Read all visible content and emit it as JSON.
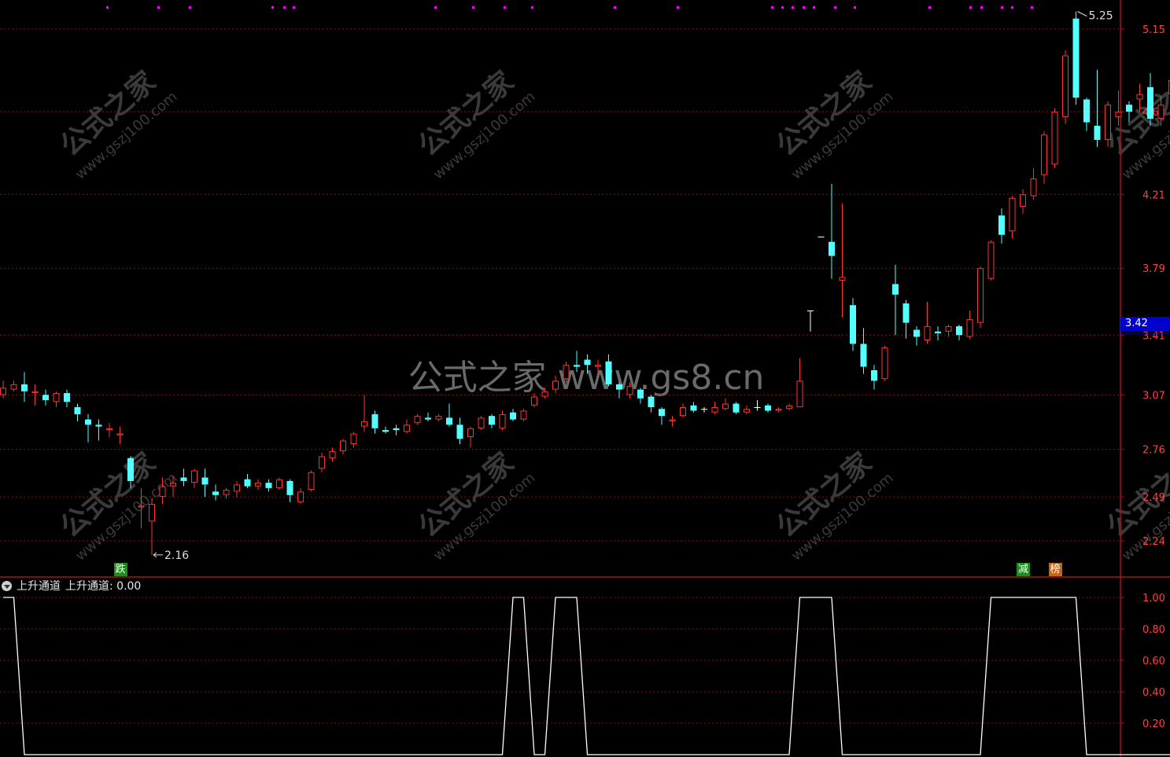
{
  "chart_data": [
    {
      "type": "candlestick",
      "price_axis": {
        "ticks": [
          "5.15",
          "4.68",
          "4.21",
          "3.79",
          "3.41",
          "3.07",
          "2.76",
          "2.49",
          "2.24"
        ],
        "ylim": [
          2.05,
          5.35
        ]
      },
      "current_price_label": "3.42",
      "max_annotation": "5.25",
      "min_annotation": "2.16",
      "watermark_center": "公式之家 www.gs8.cn",
      "watermark_tiles": [
        "公式之家",
        "www.gszj100.com"
      ],
      "signals": [
        {
          "text": "跌",
          "color": "#1e8c1e",
          "bar": 11
        },
        {
          "text": "减",
          "color": "#1e8c1e",
          "bar": 96
        },
        {
          "text": "榜",
          "color": "#c86414",
          "bar": 99
        }
      ],
      "candles": [
        [
          3.07,
          3.11,
          3.05,
          3.15
        ],
        [
          3.1,
          3.13,
          3.09,
          3.15
        ],
        [
          3.13,
          3.09,
          3.03,
          3.2
        ],
        [
          3.08,
          3.09,
          3.01,
          3.13
        ],
        [
          3.07,
          3.04,
          3.01,
          3.1
        ],
        [
          3.03,
          3.08,
          3.0,
          3.09
        ],
        [
          3.08,
          3.03,
          3.0,
          3.1
        ],
        [
          3.0,
          2.96,
          2.92,
          3.02
        ],
        [
          2.93,
          2.9,
          2.8,
          2.96
        ],
        [
          2.9,
          2.89,
          2.81,
          2.93
        ],
        [
          2.87,
          2.88,
          2.83,
          2.91
        ],
        [
          2.84,
          2.85,
          2.79,
          2.89
        ],
        [
          2.71,
          2.58,
          2.54,
          2.72
        ],
        [
          2.43,
          2.44,
          2.31,
          2.54
        ],
        [
          2.35,
          2.45,
          2.16,
          2.48
        ],
        [
          2.49,
          2.55,
          2.45,
          2.6
        ],
        [
          2.55,
          2.57,
          2.49,
          2.61
        ],
        [
          2.6,
          2.58,
          2.55,
          2.65
        ],
        [
          2.57,
          2.64,
          2.54,
          2.65
        ],
        [
          2.6,
          2.56,
          2.49,
          2.65
        ],
        [
          2.52,
          2.5,
          2.47,
          2.56
        ],
        [
          2.5,
          2.53,
          2.48,
          2.54
        ],
        [
          2.52,
          2.56,
          2.49,
          2.58
        ],
        [
          2.59,
          2.55,
          2.54,
          2.62
        ],
        [
          2.55,
          2.57,
          2.53,
          2.59
        ],
        [
          2.57,
          2.54,
          2.52,
          2.59
        ],
        [
          2.54,
          2.59,
          2.53,
          2.6
        ],
        [
          2.58,
          2.5,
          2.46,
          2.59
        ],
        [
          2.46,
          2.52,
          2.45,
          2.54
        ],
        [
          2.53,
          2.63,
          2.52,
          2.64
        ],
        [
          2.65,
          2.72,
          2.63,
          2.74
        ],
        [
          2.71,
          2.75,
          2.69,
          2.77
        ],
        [
          2.75,
          2.81,
          2.73,
          2.82
        ],
        [
          2.79,
          2.85,
          2.77,
          2.86
        ],
        [
          2.89,
          2.92,
          2.86,
          3.07
        ],
        [
          2.96,
          2.88,
          2.85,
          2.98
        ],
        [
          2.87,
          2.86,
          2.85,
          2.89
        ],
        [
          2.88,
          2.87,
          2.84,
          2.9
        ],
        [
          2.86,
          2.9,
          2.85,
          2.93
        ],
        [
          2.91,
          2.95,
          2.9,
          2.96
        ],
        [
          2.94,
          2.93,
          2.92,
          2.97
        ],
        [
          2.93,
          2.95,
          2.92,
          2.96
        ],
        [
          2.94,
          2.9,
          2.89,
          3.02
        ],
        [
          2.9,
          2.82,
          2.79,
          2.94
        ],
        [
          2.83,
          2.88,
          2.77,
          2.89
        ],
        [
          2.88,
          2.94,
          2.87,
          2.95
        ],
        [
          2.95,
          2.9,
          2.88,
          2.96
        ],
        [
          2.88,
          2.96,
          2.87,
          2.98
        ],
        [
          2.97,
          2.93,
          2.92,
          2.99
        ],
        [
          2.93,
          2.98,
          2.92,
          2.99
        ],
        [
          3.01,
          3.06,
          3.0,
          3.08
        ],
        [
          3.06,
          3.09,
          3.05,
          3.11
        ],
        [
          3.1,
          3.15,
          3.08,
          3.18
        ],
        [
          3.16,
          3.24,
          3.14,
          3.26
        ],
        [
          3.24,
          3.23,
          3.2,
          3.32
        ],
        [
          3.27,
          3.24,
          3.19,
          3.3
        ],
        [
          3.23,
          3.24,
          3.19,
          3.27
        ],
        [
          3.26,
          3.13,
          3.12,
          3.3
        ],
        [
          3.13,
          3.1,
          3.05,
          3.14
        ],
        [
          3.07,
          3.12,
          3.05,
          3.14
        ],
        [
          3.1,
          3.05,
          3.02,
          3.11
        ],
        [
          3.06,
          3.0,
          2.97,
          3.07
        ],
        [
          2.99,
          2.95,
          2.9,
          3.0
        ],
        [
          2.92,
          2.93,
          2.89,
          2.95
        ],
        [
          2.95,
          3.0,
          2.94,
          3.02
        ],
        [
          3.01,
          2.98,
          2.97,
          3.03
        ],
        [
          2.99,
          2.99,
          2.97,
          3.0
        ],
        [
          2.97,
          3.0,
          2.96,
          3.03
        ],
        [
          2.99,
          3.02,
          2.98,
          3.05
        ],
        [
          3.02,
          2.97,
          2.96,
          3.03
        ],
        [
          2.97,
          2.99,
          2.96,
          3.01
        ],
        [
          3.0,
          3.0,
          2.98,
          3.04
        ],
        [
          3.01,
          2.98,
          2.97,
          3.02
        ],
        [
          2.98,
          2.99,
          2.97,
          3.0
        ],
        [
          2.99,
          3.01,
          2.98,
          3.02
        ],
        [
          3.0,
          3.15,
          3.0,
          3.28
        ],
        [
          3.55,
          3.55,
          3.43,
          3.55
        ],
        [
          3.97,
          3.97,
          3.97,
          3.97
        ],
        [
          3.94,
          3.86,
          3.73,
          4.27
        ],
        [
          3.72,
          3.74,
          3.51,
          4.16
        ],
        [
          3.58,
          3.36,
          3.32,
          3.62
        ],
        [
          3.36,
          3.23,
          3.19,
          3.45
        ],
        [
          3.21,
          3.15,
          3.1,
          3.24
        ],
        [
          3.16,
          3.34,
          3.15,
          3.35
        ],
        [
          3.7,
          3.64,
          3.41,
          3.81
        ],
        [
          3.59,
          3.48,
          3.39,
          3.61
        ],
        [
          3.44,
          3.4,
          3.35,
          3.46
        ],
        [
          3.38,
          3.46,
          3.36,
          3.6
        ],
        [
          3.43,
          3.42,
          3.38,
          3.46
        ],
        [
          3.43,
          3.46,
          3.4,
          3.47
        ],
        [
          3.46,
          3.41,
          3.38,
          3.47
        ],
        [
          3.4,
          3.5,
          3.39,
          3.55
        ],
        [
          3.48,
          3.79,
          3.45,
          3.8
        ],
        [
          3.73,
          3.94,
          3.72,
          3.95
        ],
        [
          4.09,
          3.98,
          3.93,
          4.13
        ],
        [
          4.0,
          4.19,
          3.96,
          4.2
        ],
        [
          4.14,
          4.21,
          4.1,
          4.24
        ],
        [
          4.2,
          4.3,
          4.18,
          4.36
        ],
        [
          4.32,
          4.55,
          4.27,
          4.57
        ],
        [
          4.38,
          4.68,
          4.36,
          4.7
        ],
        [
          4.65,
          5.0,
          4.61,
          5.03
        ],
        [
          5.21,
          4.76,
          4.72,
          5.25
        ],
        [
          4.75,
          4.62,
          4.57,
          4.76
        ],
        [
          4.6,
          4.52,
          4.48,
          4.92
        ],
        [
          4.52,
          4.72,
          4.48,
          4.74
        ],
        [
          4.65,
          4.68,
          4.6,
          4.8
        ],
        [
          4.72,
          4.68,
          4.62,
          4.74
        ],
        [
          4.75,
          4.78,
          4.68,
          4.84
        ],
        [
          4.82,
          4.64,
          4.6,
          4.9
        ],
        [
          4.64,
          4.72,
          4.6,
          4.77
        ],
        [
          4.78,
          4.86,
          4.73,
          4.92
        ]
      ]
    },
    {
      "type": "line",
      "name": "上升通道",
      "header_label": "上升通道",
      "value_label": "上升通道: 0.00",
      "y_ticks": [
        "1.00",
        "0.80",
        "0.60",
        "0.40",
        "0.20"
      ],
      "ylim": [
        0,
        1.13
      ],
      "values": [
        1,
        1,
        0,
        0,
        0,
        0,
        0,
        0,
        0,
        0,
        0,
        0,
        0,
        0,
        0,
        0,
        0,
        0,
        0,
        0,
        0,
        0,
        0,
        0,
        0,
        0,
        0,
        0,
        0,
        0,
        0,
        0,
        0,
        0,
        0,
        0,
        0,
        0,
        0,
        0,
        0,
        0,
        0,
        0,
        0,
        0,
        0,
        0,
        1,
        1,
        0,
        0,
        1,
        1,
        1,
        0,
        0,
        0,
        0,
        0,
        0,
        0,
        0,
        0,
        0,
        0,
        0,
        0,
        0,
        0,
        0,
        0,
        0,
        0,
        0,
        1,
        1,
        1,
        1,
        0,
        0,
        0,
        0,
        0,
        0,
        0,
        0,
        0,
        0,
        0,
        0,
        0,
        0,
        1,
        1,
        1,
        1,
        1,
        1,
        1,
        1,
        1,
        0,
        0,
        0,
        0,
        0,
        0,
        0,
        0,
        0
      ]
    }
  ],
  "colors": {
    "up": "#ff3232",
    "down": "#54ffff",
    "flat": "#ffffff",
    "grid": "#8c1010",
    "axis": "#b01010",
    "tick_text": "#ff4040",
    "line": "#ffffff",
    "magenta_dots": "#ff00ff"
  }
}
